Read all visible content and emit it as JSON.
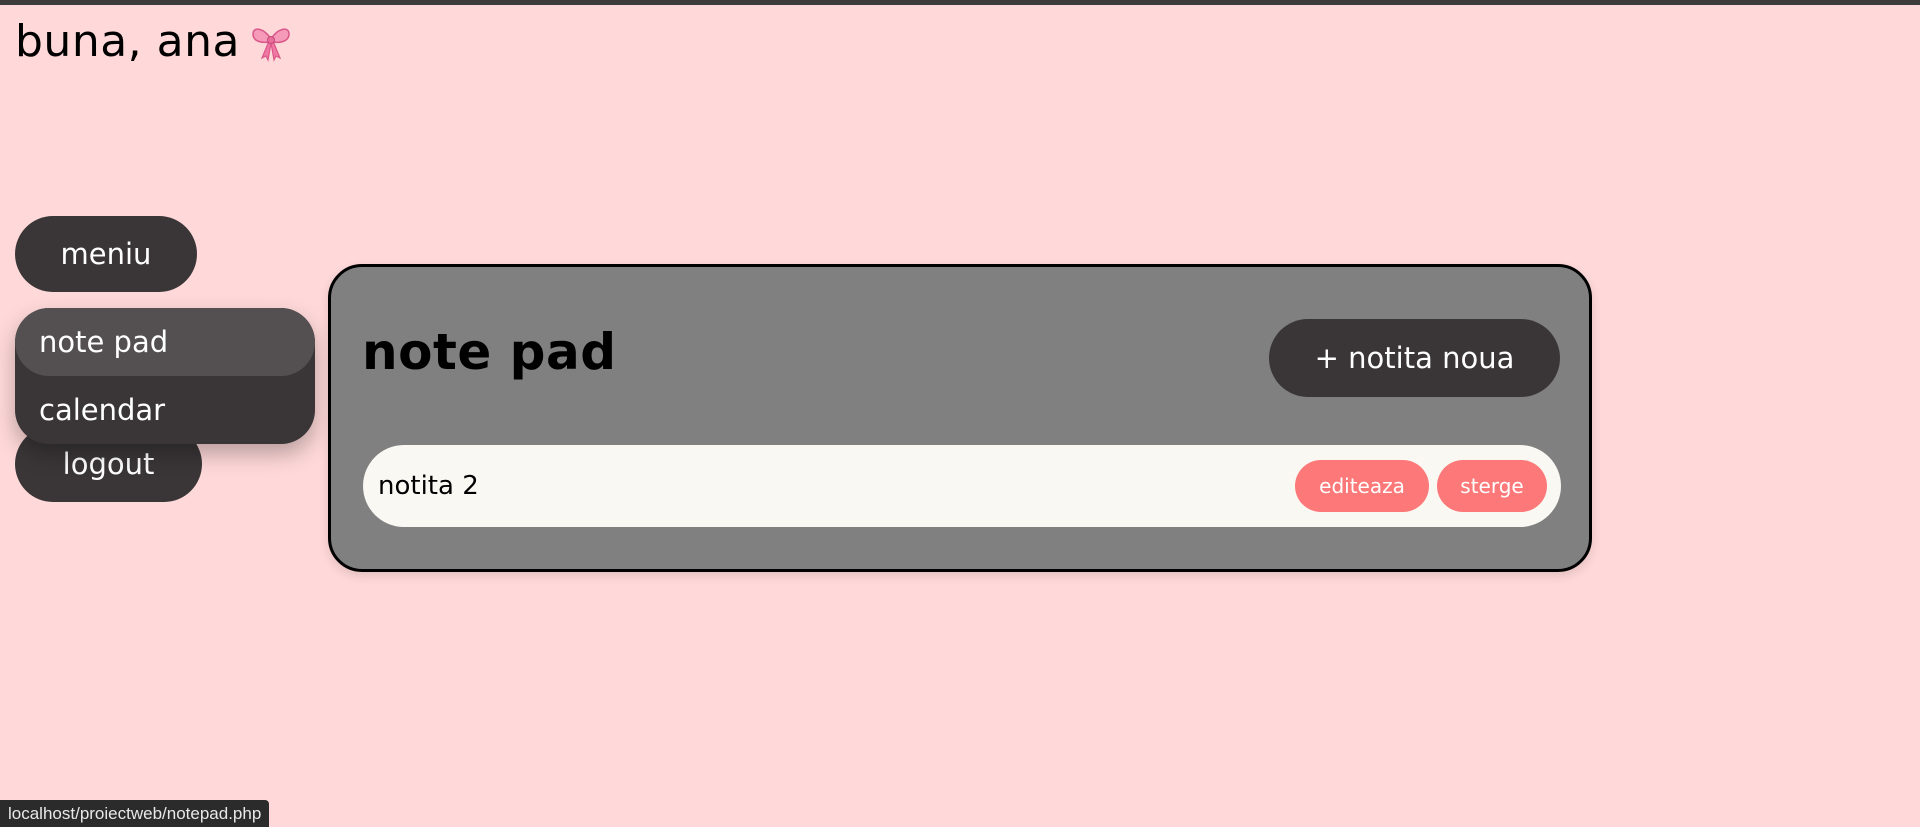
{
  "header": {
    "greeting": "buna, ana",
    "icon": "bow-icon"
  },
  "sidebar": {
    "menu_label": "meniu",
    "dropdown_items": [
      {
        "label": "note pad",
        "active": true
      },
      {
        "label": "calendar",
        "active": false
      }
    ],
    "logout_label": "logout"
  },
  "panel": {
    "title": "note pad",
    "new_note_label": "+ notita noua",
    "notes": [
      {
        "title": "notita 2",
        "edit_label": "editeaza",
        "delete_label": "sterge"
      }
    ]
  },
  "status_bar": {
    "url": "localhost/proiectweb/notepad.php"
  },
  "colors": {
    "background": "#ffd9d9",
    "dark_button": "#3a3637",
    "panel": "#808080",
    "action_button": "#fd7878",
    "note_row": "#faf8f3"
  }
}
